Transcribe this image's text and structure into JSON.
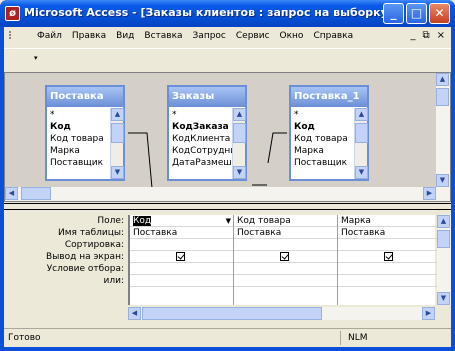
{
  "window": {
    "title": "Microsoft Access - [Заказы клиентов : запрос на выборку]",
    "minimize_symbol": "_",
    "maximize_symbol": "□",
    "close_symbol": "✕"
  },
  "menu": {
    "items": [
      "Файл",
      "Правка",
      "Вид",
      "Вставка",
      "Запрос",
      "Сервис",
      "Окно",
      "Справка"
    ],
    "mdi_min": "_",
    "mdi_restore": "⧉",
    "mdi_close": "×"
  },
  "toolbar": {
    "chevron": "▾"
  },
  "tables": [
    {
      "name": "Поставка",
      "fields": [
        "*",
        "Код",
        "Код товара",
        "Марка",
        "Поставщик"
      ],
      "key_field": "Код"
    },
    {
      "name": "Заказы",
      "fields": [
        "*",
        "КодЗаказа",
        "КодКлиента",
        "КодСотрудни",
        "ДатаРазмеш"
      ],
      "key_field": "КодЗаказа"
    },
    {
      "name": "Поставка_1",
      "fields": [
        "*",
        "Код",
        "Код товара",
        "Марка",
        "Поставщик"
      ],
      "key_field": "Код"
    }
  ],
  "grid": {
    "row_labels": [
      "Поле:",
      "Имя таблицы:",
      "Сортировка:",
      "Вывод на экран:",
      "Условие отбора:",
      "или:"
    ],
    "columns": [
      {
        "field": "Код",
        "table": "Поставка",
        "sort": "",
        "show": true
      },
      {
        "field": "Код товара",
        "table": "Поставка",
        "sort": "",
        "show": true
      },
      {
        "field": "Марка",
        "table": "Поставка",
        "sort": "",
        "show": true
      }
    ],
    "dropdown_symbol": "▼"
  },
  "status": {
    "text": "Готово",
    "mode": "NLM"
  },
  "colors": {
    "titlebar": "#0651d8",
    "table_header": "#6b8ed6",
    "window_bg": "#ece9d8"
  }
}
